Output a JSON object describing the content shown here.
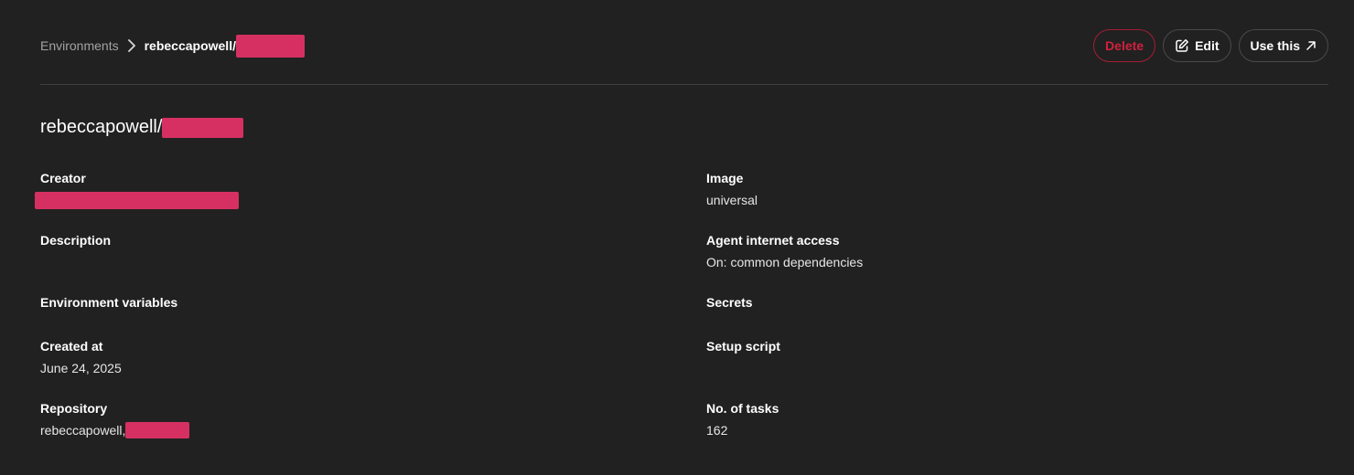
{
  "breadcrumb": {
    "root_label": "Environments",
    "current_label": "rebeccapowell/"
  },
  "toolbar": {
    "delete_label": "Delete",
    "edit_label": "Edit",
    "use_label": "Use this"
  },
  "title": {
    "text": "rebeccapowell/"
  },
  "fields": {
    "creator": {
      "label": "Creator",
      "value": ""
    },
    "image": {
      "label": "Image",
      "value": "universal"
    },
    "description": {
      "label": "Description",
      "value": ""
    },
    "agent_internet_access": {
      "label": "Agent internet access",
      "value": "On: common dependencies"
    },
    "environment_variables": {
      "label": "Environment variables",
      "value": ""
    },
    "secrets": {
      "label": "Secrets",
      "value": ""
    },
    "created_at": {
      "label": "Created at",
      "value": "June 24, 2025"
    },
    "setup_script": {
      "label": "Setup script",
      "value": ""
    },
    "repository": {
      "label": "Repository",
      "value": "rebeccapowell,"
    },
    "no_of_tasks": {
      "label": "No. of tasks",
      "value": "162"
    }
  },
  "icons": {
    "breadcrumb_separator": "chevron-right-icon",
    "edit": "pencil-square-icon",
    "use_this": "arrow-up-right-icon"
  },
  "colors": {
    "background": "#212121",
    "delete_accent": "#d0203e",
    "redaction": "#d63063",
    "muted_text": "#a3a3a3"
  }
}
